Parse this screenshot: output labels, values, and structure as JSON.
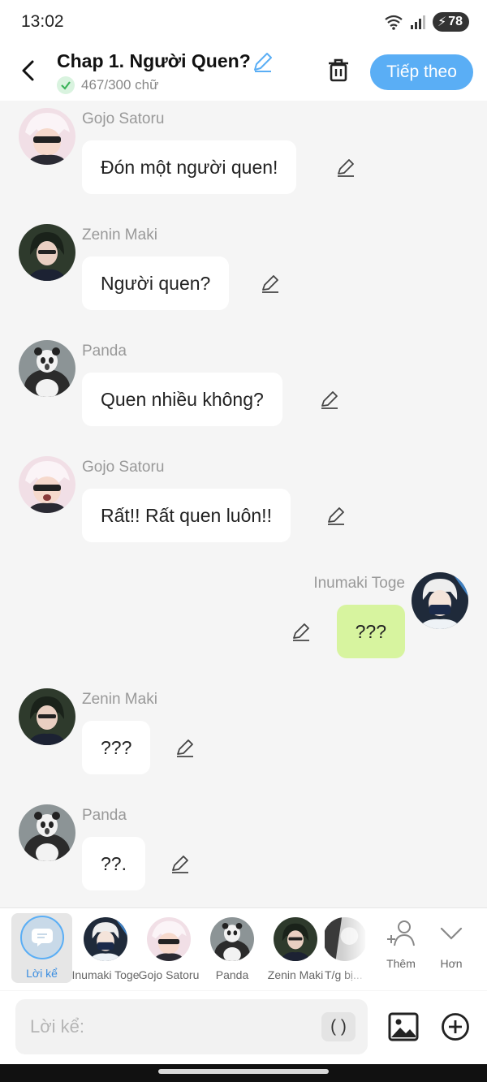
{
  "status_bar": {
    "time": "13:02",
    "battery": "78",
    "icons": [
      "wifi-icon",
      "signal-icon",
      "battery-icon"
    ]
  },
  "header": {
    "title": "Chap 1. Người Quen?",
    "word_count": "467/300 chữ",
    "next_label": "Tiếp theo"
  },
  "colors": {
    "accent": "#5aaef5",
    "right_bubble": "#d7f49f",
    "bubble": "#ffffff",
    "background": "#f5f5f5"
  },
  "messages": [
    {
      "speaker": "Gojo Satoru",
      "text": "Đón một người quen!",
      "side": "left"
    },
    {
      "speaker": "Zenin Maki",
      "text": "Người quen?",
      "side": "left"
    },
    {
      "speaker": "Panda",
      "text": "Quen nhiều không?",
      "side": "left"
    },
    {
      "speaker": "Gojo Satoru",
      "text": "Rất!! Rất quen luôn!!",
      "side": "left"
    },
    {
      "speaker": "Inumaki Toge",
      "text": "???",
      "side": "right"
    },
    {
      "speaker": "Zenin Maki",
      "text": "???",
      "side": "left"
    },
    {
      "speaker": "Panda",
      "text": "??.",
      "side": "left"
    }
  ],
  "characters": [
    {
      "label": "Lời kể",
      "selected": true
    },
    {
      "label": "Inumaki Toge"
    },
    {
      "label": "Gojo Satoru"
    },
    {
      "label": "Panda"
    },
    {
      "label": "Zenin Maki"
    },
    {
      "label": "T/g bị..."
    }
  ],
  "tools": {
    "add_label": "Thêm",
    "more_label": "Hơn"
  },
  "input": {
    "placeholder": "Lời kể:",
    "paren_label": "( )"
  }
}
